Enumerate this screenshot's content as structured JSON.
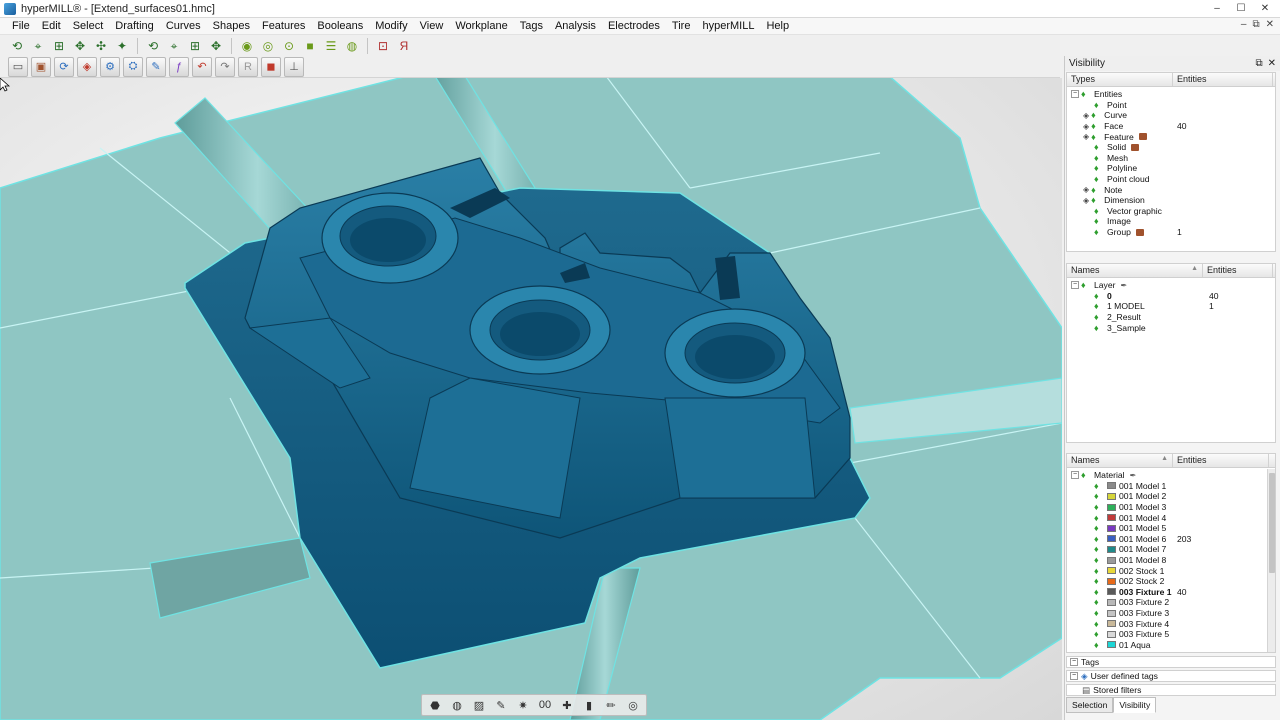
{
  "window": {
    "title": "hyperMILL® - [Extend_surfaces01.hmc]",
    "min": "–",
    "max": "☐",
    "close": "✕"
  },
  "menu": [
    "File",
    "Edit",
    "Select",
    "Drafting",
    "Curves",
    "Shapes",
    "Features",
    "Booleans",
    "Modify",
    "View",
    "Workplane",
    "Tags",
    "Analysis",
    "Electrodes",
    "Tire",
    "hyperMILL",
    "Help"
  ],
  "mdi_controls": {
    "min": "–",
    "max": "⧉",
    "close": "✕"
  },
  "toolbar1_icons": [
    "curve-lasso-icon",
    "curve-select-icon",
    "curve-box-icon",
    "curve-node-icon",
    "curve-cross-icon",
    "curve-pick-icon",
    "face-lasso-icon",
    "face-select-icon",
    "face-box-icon",
    "face-node-icon",
    "solid-cylinder-icon",
    "solid-stack-icon",
    "solid-disc-icon",
    "solid-box-icon",
    "solid-layers-icon",
    "solid-torus-icon",
    "dim-icon",
    "dim-r-icon"
  ],
  "toolbar2_icons": [
    "new-doc-icon",
    "open-icon",
    "save-icon",
    "model-icon",
    "tool-icon",
    "fixture-icon",
    "edit-icon",
    "curve-edit-icon",
    "undo-icon",
    "redo-icon",
    "redo-r-icon",
    "cube-view-icon",
    "pin-icon"
  ],
  "viewbar_icons": [
    "shade-icon",
    "sphere-icon",
    "hatch-icon",
    "draw-icon",
    "spark-icon",
    "zero-zero-icon",
    "pointer-icon",
    "marker-icon",
    "pencil-icon",
    "grid-sphere-icon"
  ],
  "viewbar_labels": {
    "zero_zero": "00"
  },
  "visibility": {
    "title": "Visibility",
    "pin": "⧉",
    "close": "✕",
    "types_header": {
      "col1": "Types",
      "col2": "Entities"
    },
    "types_root": "Entities",
    "types": [
      {
        "label": "Point",
        "count": "",
        "expandable": false,
        "cube": false
      },
      {
        "label": "Curve",
        "count": "",
        "expandable": true,
        "cube": false
      },
      {
        "label": "Face",
        "count": "40",
        "expandable": true,
        "cube": false
      },
      {
        "label": "Feature",
        "count": "",
        "expandable": true,
        "cube": true
      },
      {
        "label": "Solid",
        "count": "",
        "expandable": false,
        "cube": true
      },
      {
        "label": "Mesh",
        "count": "",
        "expandable": false,
        "cube": false
      },
      {
        "label": "Polyline",
        "count": "",
        "expandable": false,
        "cube": false
      },
      {
        "label": "Point cloud",
        "count": "",
        "expandable": false,
        "cube": false
      },
      {
        "label": "Note",
        "count": "",
        "expandable": true,
        "cube": false
      },
      {
        "label": "Dimension",
        "count": "",
        "expandable": true,
        "cube": false
      },
      {
        "label": "Vector graphic",
        "count": "",
        "expandable": false,
        "cube": false
      },
      {
        "label": "Image",
        "count": "",
        "expandable": false,
        "cube": false
      },
      {
        "label": "Group",
        "count": "1",
        "expandable": false,
        "cube": true
      }
    ],
    "names_header": {
      "col1": "Names",
      "col2": "Entities",
      "sort": "▲"
    },
    "layer_root": "Layer",
    "layers": [
      {
        "label": "0",
        "count": "40",
        "bold": true
      },
      {
        "label": "1 MODEL",
        "count": "1",
        "bold": false
      },
      {
        "label": "2_Result",
        "count": "",
        "bold": false
      },
      {
        "label": "3_Sample",
        "count": "",
        "bold": false
      }
    ],
    "material_root": "Material",
    "materials": [
      {
        "label": "001 Model 1",
        "count": "",
        "color": "#8a8a8a",
        "bold": false
      },
      {
        "label": "001 Model 2",
        "count": "",
        "color": "#d6d63a",
        "bold": false
      },
      {
        "label": "001 Model 3",
        "count": "",
        "color": "#2db05a",
        "bold": false
      },
      {
        "label": "001 Model 4",
        "count": "",
        "color": "#c23a3a",
        "bold": false
      },
      {
        "label": "001 Model 5",
        "count": "",
        "color": "#7a3ac2",
        "bold": false
      },
      {
        "label": "001 Model 6",
        "count": "203",
        "color": "#3a5ec2",
        "bold": false
      },
      {
        "label": "001 Model 7",
        "count": "",
        "color": "#1f8a8a",
        "bold": false
      },
      {
        "label": "001 Model 8",
        "count": "",
        "color": "#9a9a9a",
        "bold": false
      },
      {
        "label": "002 Stock 1",
        "count": "",
        "color": "#e8d83a",
        "bold": false
      },
      {
        "label": "002 Stock 2",
        "count": "",
        "color": "#e86a1a",
        "bold": false
      },
      {
        "label": "003 Fixture 1",
        "count": "40",
        "color": "#5a5a5a",
        "bold": true
      },
      {
        "label": "003 Fixture 2",
        "count": "",
        "color": "#b8b8b8",
        "bold": false
      },
      {
        "label": "003 Fixture 3",
        "count": "",
        "color": "#c4c4c4",
        "bold": false
      },
      {
        "label": "003 Fixture 4",
        "count": "",
        "color": "#c9b99a",
        "bold": false
      },
      {
        "label": "003 Fixture 5",
        "count": "",
        "color": "#d9d9d9",
        "bold": false
      },
      {
        "label": "01 Aqua",
        "count": "",
        "color": "#1ed6d6",
        "bold": false
      }
    ],
    "tags_label": "Tags",
    "user_tags_label": "User defined tags",
    "stored_filters_label": "Stored filters",
    "tab_selection": "Selection",
    "tab_visibility": "Visibility"
  }
}
